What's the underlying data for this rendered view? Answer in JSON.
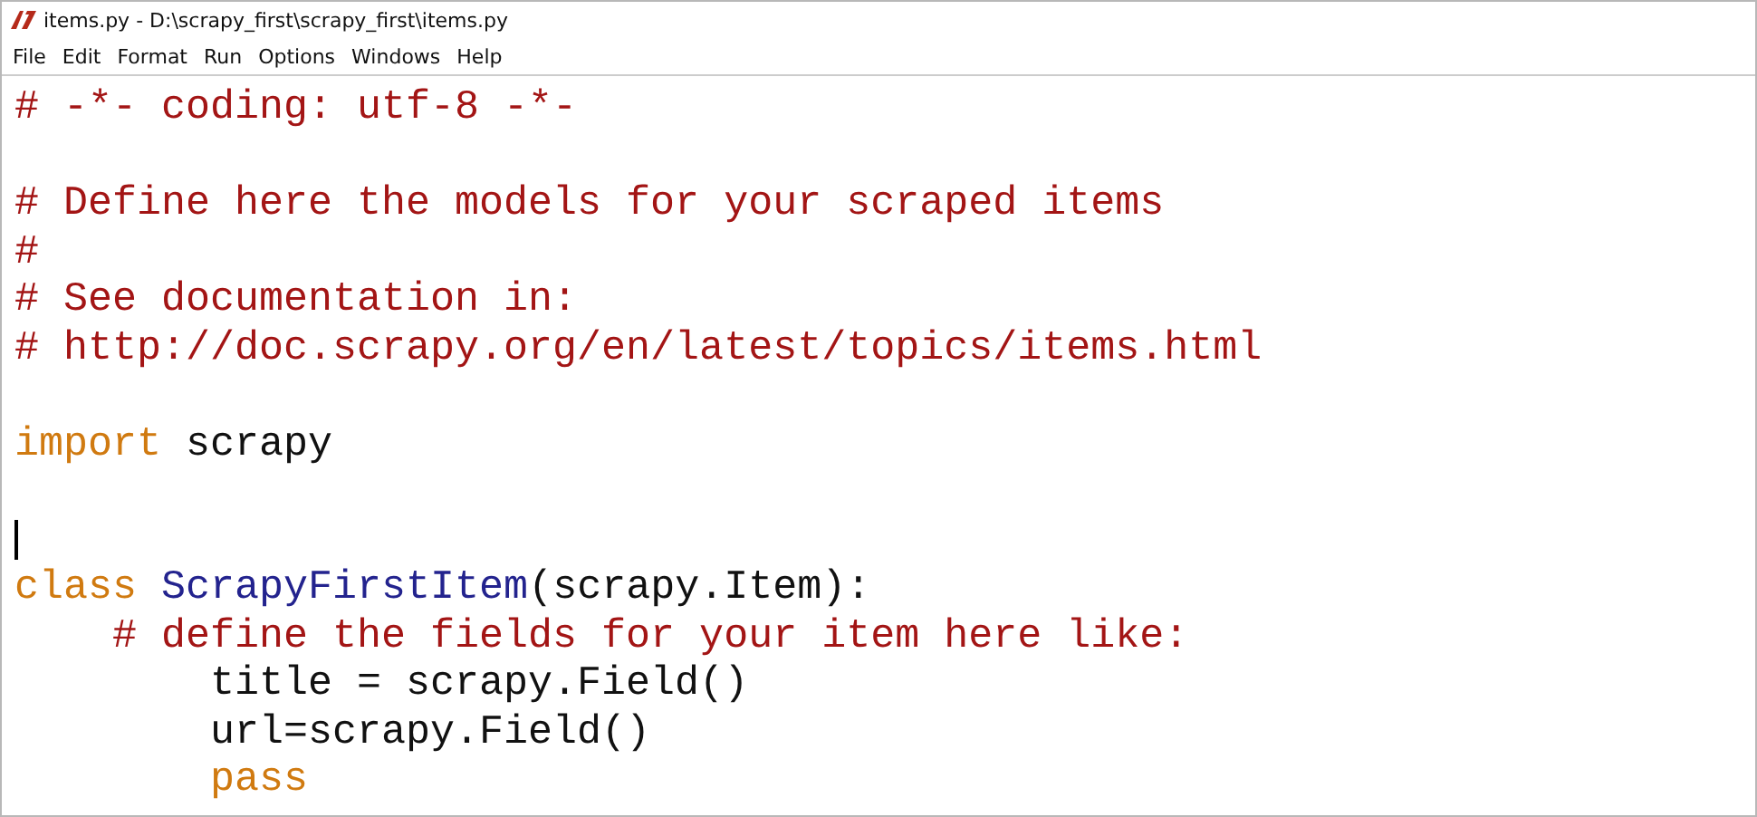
{
  "window": {
    "title": "items.py - D:\\scrapy_first\\scrapy_first\\items.py"
  },
  "menu": [
    "File",
    "Edit",
    "Format",
    "Run",
    "Options",
    "Windows",
    "Help"
  ],
  "editor": {
    "lines": [
      {
        "kind": "text",
        "tokens": [
          {
            "kind": "comment",
            "text": "# -*- coding: utf-8 -*-"
          }
        ]
      },
      {
        "kind": "blank"
      },
      {
        "kind": "text",
        "tokens": [
          {
            "kind": "comment",
            "text": "# Define here the models for your scraped items"
          }
        ]
      },
      {
        "kind": "text",
        "tokens": [
          {
            "kind": "comment",
            "text": "#"
          }
        ]
      },
      {
        "kind": "text",
        "tokens": [
          {
            "kind": "comment",
            "text": "# See documentation in:"
          }
        ]
      },
      {
        "kind": "text",
        "tokens": [
          {
            "kind": "comment",
            "text": "# http://doc.scrapy.org/en/latest/topics/items.html"
          }
        ]
      },
      {
        "kind": "blank"
      },
      {
        "kind": "text",
        "tokens": [
          {
            "kind": "keyword",
            "text": "import"
          },
          {
            "kind": "plain",
            "text": " scrapy"
          }
        ]
      },
      {
        "kind": "blank"
      },
      {
        "kind": "cursor"
      },
      {
        "kind": "text",
        "tokens": [
          {
            "kind": "keyword",
            "text": "class"
          },
          {
            "kind": "definition",
            "text": " ScrapyFirstItem"
          },
          {
            "kind": "plain",
            "text": "(scrapy.Item):"
          }
        ]
      },
      {
        "kind": "text",
        "tokens": [
          {
            "kind": "comment",
            "text": "    # define the fields for your item here like:"
          }
        ]
      },
      {
        "kind": "text",
        "tokens": [
          {
            "kind": "plain",
            "text": "        title = scrapy.Field()"
          }
        ]
      },
      {
        "kind": "text",
        "tokens": [
          {
            "kind": "plain",
            "text": "        url=scrapy.Field()"
          }
        ]
      },
      {
        "kind": "text",
        "tokens": [
          {
            "kind": "keyword",
            "text": "        pass"
          }
        ]
      }
    ]
  }
}
